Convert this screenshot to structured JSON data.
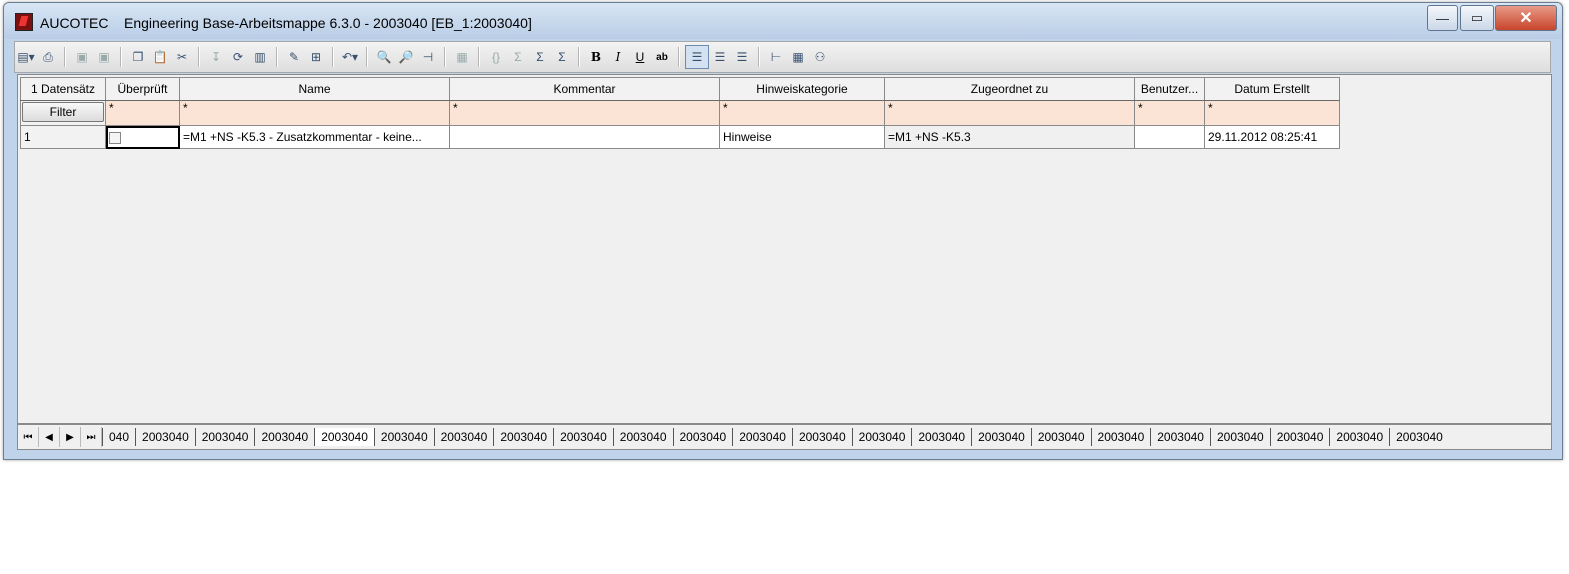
{
  "window": {
    "brand": "AUCOTEC",
    "title": "Engineering Base-Arbeitsmappe 6.3.0 - 2003040 [EB_1:2003040]",
    "controls": {
      "minimize": "—",
      "maximize": "▭",
      "close": "✕"
    }
  },
  "toolbar": {
    "icons": [
      "new-icon",
      "print-icon",
      "save-icon",
      "save-all-icon",
      "copy-icon",
      "paste-icon",
      "cut-icon",
      "sort-icon",
      "refresh-icon",
      "columns-icon",
      "edit-icon",
      "insert-icon",
      "undo-icon",
      "find-icon",
      "find-replace-icon",
      "pin-icon",
      "properties-icon",
      "bracket-icon",
      "sum-icon",
      "sum-total-icon",
      "sum-selection-icon",
      "bold-icon",
      "italic-icon",
      "underline-icon",
      "strikethrough-icon",
      "align-left-icon",
      "align-center-icon",
      "align-right-icon",
      "tree-icon",
      "layout-icon",
      "hierarchy-icon"
    ],
    "bold_label": "B",
    "italic_label": "I",
    "underline_label": "U",
    "strike_label": "ab"
  },
  "grid": {
    "record_count": "1 Datensätz",
    "columns": [
      "Überprüft",
      "Name",
      "Kommentar",
      "Hinweiskategorie",
      "Zugeordnet zu",
      "Benutzer...",
      "Datum Erstellt"
    ],
    "filter_button": "Filter",
    "filter_wildcard": "*",
    "rows": [
      {
        "index": "1",
        "checked": false,
        "name": "=M1 +NS -K5.3 - Zusatzkommentar - keine...",
        "comment": "",
        "category": "Hinweise",
        "assigned_to": "=M1 +NS -K5.3",
        "user": "",
        "created": "29.11.2012  08:25:41"
      }
    ]
  },
  "tabs": {
    "nav": [
      "⏮",
      "◀",
      "▶",
      "⏭"
    ],
    "first_partial": "040",
    "label": "2003040",
    "count": 22,
    "active_index": 3
  },
  "colors": {
    "filter_row": "#fbe4d5",
    "titlebar": "#bfd3ea"
  }
}
